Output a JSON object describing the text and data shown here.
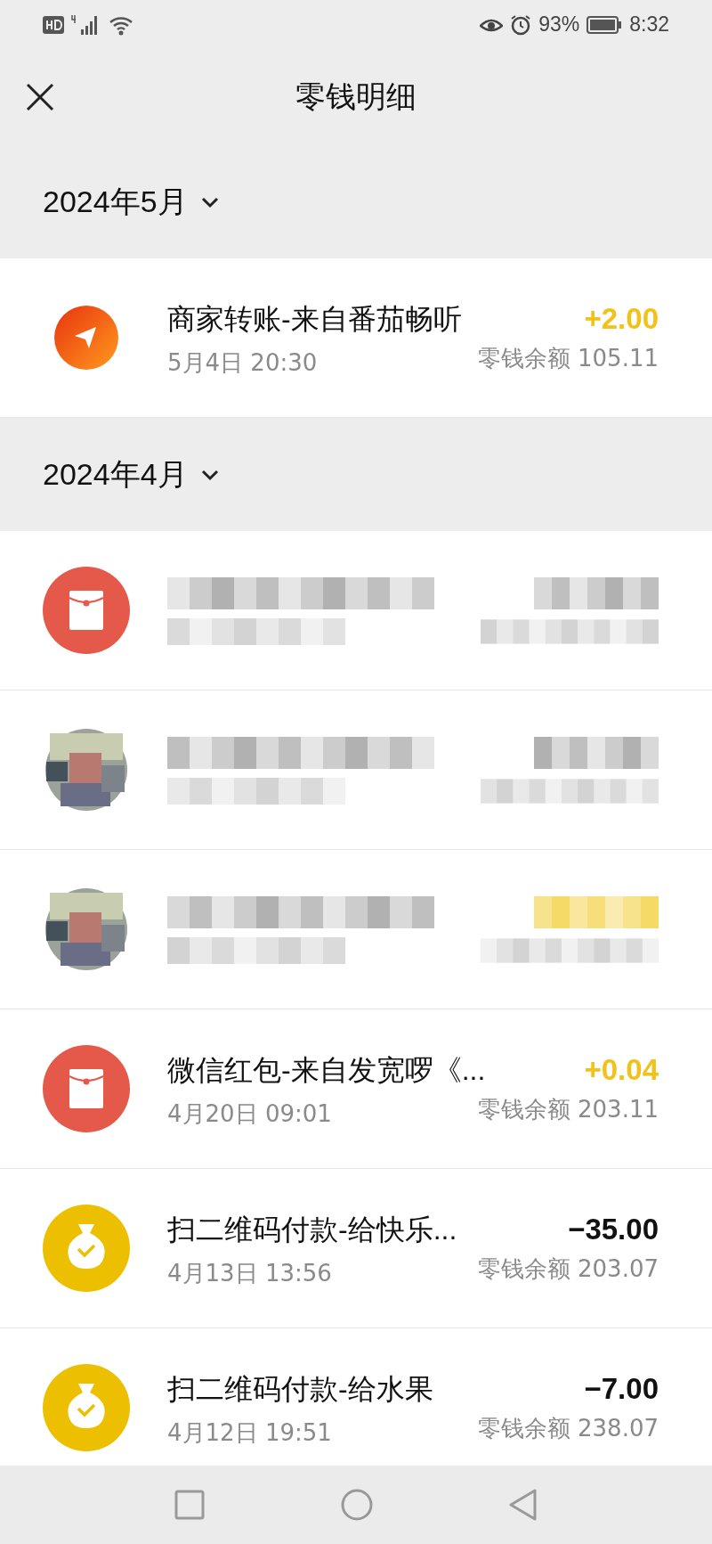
{
  "status_bar": {
    "battery": "93%",
    "time": "8:32"
  },
  "header": {
    "title": "零钱明细"
  },
  "groups": [
    {
      "month": "2024年5月",
      "items": [
        {
          "kind": "transfer",
          "title": "商家转账-来自番茄畅听",
          "date": "5月4日 20:30",
          "amount": "+2.00",
          "income": true,
          "balance": "零钱余额 105.11"
        }
      ]
    },
    {
      "month": "2024年4月",
      "items": [
        {
          "kind": "hidden_envelope",
          "income": false
        },
        {
          "kind": "hidden_photo",
          "income": false
        },
        {
          "kind": "hidden_photo",
          "income": true
        },
        {
          "kind": "envelope",
          "title": "微信红包-来自发宽啰《...",
          "date": "4月20日 09:01",
          "amount": "+0.04",
          "income": true,
          "balance": "零钱余额 203.11"
        },
        {
          "kind": "payment",
          "title": "扫二维码付款-给快乐...",
          "date": "4月13日 13:56",
          "amount": "−35.00",
          "income": false,
          "balance": "零钱余额 203.07"
        },
        {
          "kind": "payment",
          "title": "扫二维码付款-给水果",
          "date": "4月12日 19:51",
          "amount": "−7.00",
          "income": false,
          "balance": "零钱余额 238.07"
        }
      ]
    }
  ]
}
